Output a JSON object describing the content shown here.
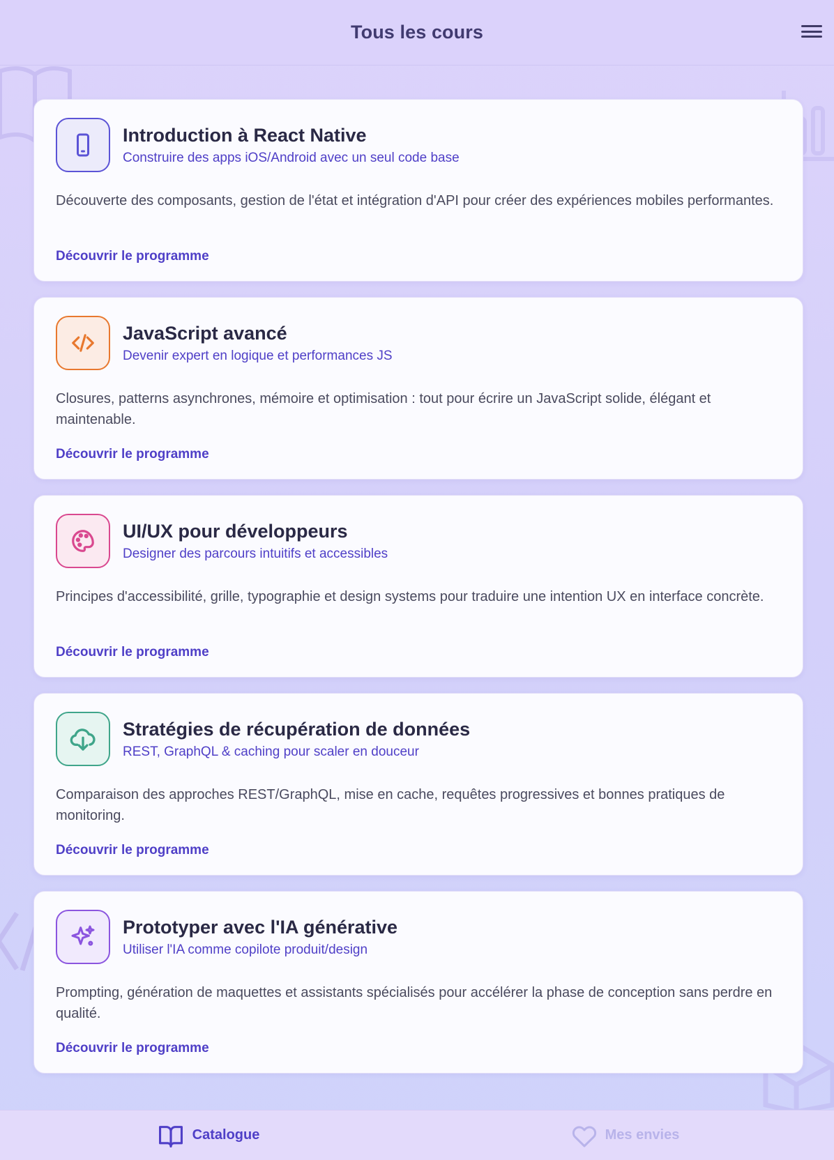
{
  "header": {
    "title": "Tous les cours",
    "menu_icon": "hamburger-menu-icon"
  },
  "courses": [
    {
      "title": "Introduction à React Native",
      "subtitle": "Construire des apps iOS/Android avec un seul code base",
      "description": "Découverte des composants, gestion de l'état et intégration d'API pour créer des expériences mobiles performantes.",
      "link": "Découvrir le programme",
      "icon": "smartphone-icon",
      "accent": "#5b53d6",
      "icon_bg": "#ecebfb"
    },
    {
      "title": "JavaScript avancé",
      "subtitle": "Devenir expert en logique et performances JS",
      "description": "Closures, patterns asynchrones, mémoire et optimisation : tout pour écrire un JavaScript solide, élégant et maintenable.",
      "link": "Découvrir le programme",
      "icon": "code-icon",
      "accent": "#e8782e",
      "icon_bg": "#fcece4"
    },
    {
      "title": "UI/UX pour développeurs",
      "subtitle": "Designer des parcours intuitifs et accessibles",
      "description": "Principes d'accessibilité, grille, typographie et design systems pour traduire une intention UX en interface concrète.",
      "link": "Découvrir le programme",
      "icon": "palette-icon",
      "accent": "#d9488f",
      "icon_bg": "#fbe9f1"
    },
    {
      "title": "Stratégies de récupération de données",
      "subtitle": "REST, GraphQL & caching pour scaler en douceur",
      "description": "Comparaison des approches REST/GraphQL, mise en cache, requêtes progressives et bonnes pratiques de monitoring.",
      "link": "Découvrir le programme",
      "icon": "cloud-download-icon",
      "accent": "#3fa58a",
      "icon_bg": "#e6f5f1"
    },
    {
      "title": "Prototyper avec l'IA générative",
      "subtitle": "Utiliser l'IA comme copilote produit/design",
      "description": "Prompting, génération de maquettes et assistants spécialisés pour accélérer la phase de conception sans perdre en qualité.",
      "link": "Découvrir le programme",
      "icon": "sparkles-icon",
      "accent": "#8b55df",
      "icon_bg": "#f1eafd"
    }
  ],
  "tabs": [
    {
      "label": "Catalogue",
      "icon": "book-icon",
      "active": true
    },
    {
      "label": "Mes envies",
      "icon": "heart-icon",
      "active": false
    }
  ]
}
